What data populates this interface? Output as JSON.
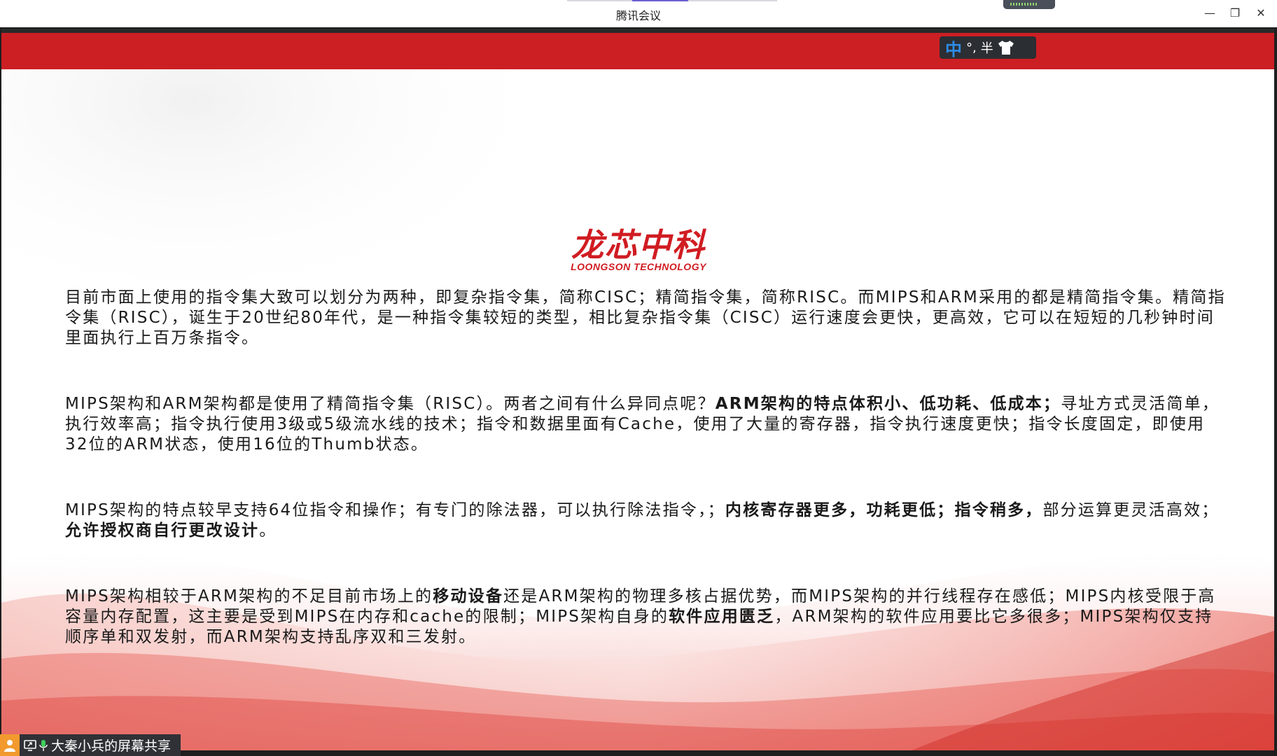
{
  "window": {
    "title": "腾讯会议",
    "controls": {
      "minimize": "—",
      "restore": "❐",
      "close": "✕"
    }
  },
  "ime": {
    "mode": "中",
    "punct": "°,",
    "width": "半"
  },
  "slide": {
    "logo_cn": "龙芯中科",
    "logo_en": "LOONGSON TECHNOLOGY",
    "p1": "目前市面上使用的指令集大致可以划分为两种，即复杂指令集，简称CISC；精简指令集，简称RISC。而MIPS和ARM采用的都是精简指令集。精简指令集（RISC），诞生于20世纪80年代，是一种指令集较短的类型，相比复杂指令集（CISC）运行速度会更快，更高效，它可以在短短的几秒钟时间里面执行上百万条指令。",
    "p2_a": "MIPS架构和ARM架构都是使用了精简指令集（RISC）。两者之间有什么异同点呢？",
    "p2_b": "ARM架构的特点体积小、低功耗、低成本；",
    "p2_c": "寻址方式灵活简单，执行效率高；指令执行使用3级或5级流水线的技术；指令和数据里面有Cache，使用了大量的寄存器，指令执行速度更快；指令长度固定，即使用32位的ARM状态，使用16位的Thumb状态。",
    "p3_a": "MIPS架构的特点较早支持64位指令和操作；有专门的除法器，可以执行除法指令，；",
    "p3_b": "内核寄存器更多，功耗更低；指令稍多，",
    "p3_c": "部分运算更灵活高效；",
    "p3_d": "允许授权商自行更改设计",
    "p3_e": "。",
    "p4_a": "MIPS架构相较于ARM架构的不足目前市场上的",
    "p4_b": "移动设备",
    "p4_c": "还是ARM架构的物理多核占据优势，而MIPS架构的并行线程存在感低；MIPS内核受限于高容量内存配置，这主要是受到MIPS在内存和cache的限制；MIPS架构自身的",
    "p4_d": "软件应用匮乏",
    "p4_e": "，ARM架构的软件应用要比它多很多；MIPS架构仅支持顺序单和双发射，而ARM架构支持乱序双和三发射。"
  },
  "share_badge": {
    "label": "大秦小兵的屏幕共享"
  },
  "colors": {
    "brand_red": "#cc1f24",
    "title_bg": "#ffffff"
  }
}
